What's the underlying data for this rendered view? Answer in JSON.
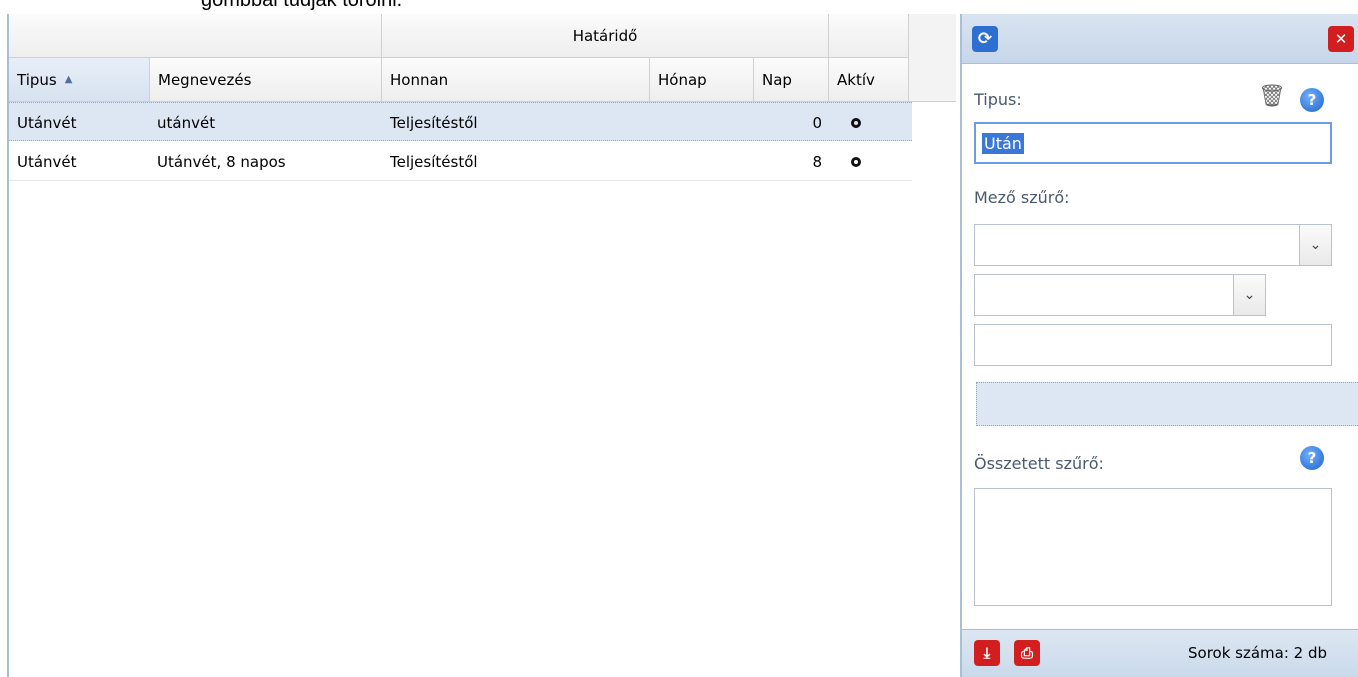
{
  "top_text": "gombbal tudják törölni.",
  "grid": {
    "group_header": "Határidő",
    "columns": [
      {
        "label": "Tipus",
        "sorted": "asc"
      },
      {
        "label": "Megnevezés"
      },
      {
        "label": "Honnan"
      },
      {
        "label": "Hónap"
      },
      {
        "label": "Nap"
      },
      {
        "label": "Aktív"
      }
    ],
    "rows": [
      {
        "tipus": "Utánvét",
        "megnevezes": "utánvét",
        "honnan": "Teljesítéstől",
        "honap": "",
        "nap": "0",
        "selected": true
      },
      {
        "tipus": "Utánvét",
        "megnevezes": "Utánvét, 8 napos",
        "honnan": "Teljesítéstől",
        "honap": "",
        "nap": "8",
        "selected": false
      }
    ]
  },
  "panel": {
    "icons": {
      "refresh": "refresh-icon",
      "close": "close-icon",
      "trash": "trash-icon",
      "help": "help-icon",
      "download": "download-icon",
      "print": "print-icon"
    },
    "tipus_label": "Tipus:",
    "tipus_value": "Után",
    "mezo_szuro_label": "Mező szűrő:",
    "osszetett_label": "Összetett szűrő:",
    "footer_text": "Sorok száma: 2 db"
  },
  "colors": {
    "accent": "#2d6fd1",
    "danger": "#d21e1e",
    "selection": "#dde6f3"
  }
}
